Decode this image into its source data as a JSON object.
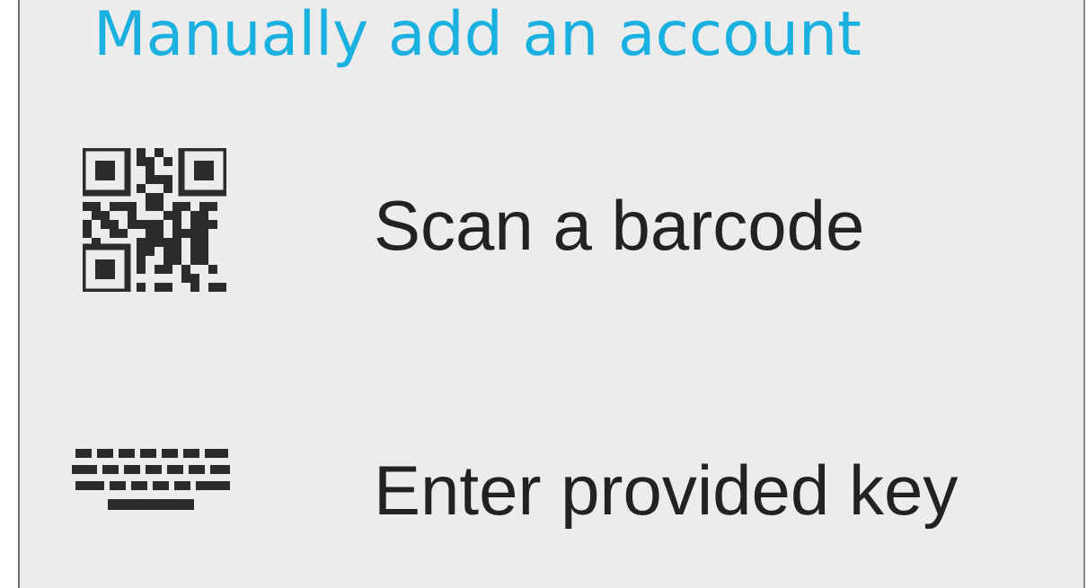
{
  "header": {
    "title": "Manually add an account"
  },
  "options": [
    {
      "label": "Scan a barcode",
      "icon": "qr-code-icon"
    },
    {
      "label": "Enter provided key",
      "icon": "keyboard-icon"
    }
  ],
  "colors": {
    "accent": "#1ab0e0",
    "background": "#ececec",
    "text": "#222222",
    "icon": "#2b2b2b"
  }
}
